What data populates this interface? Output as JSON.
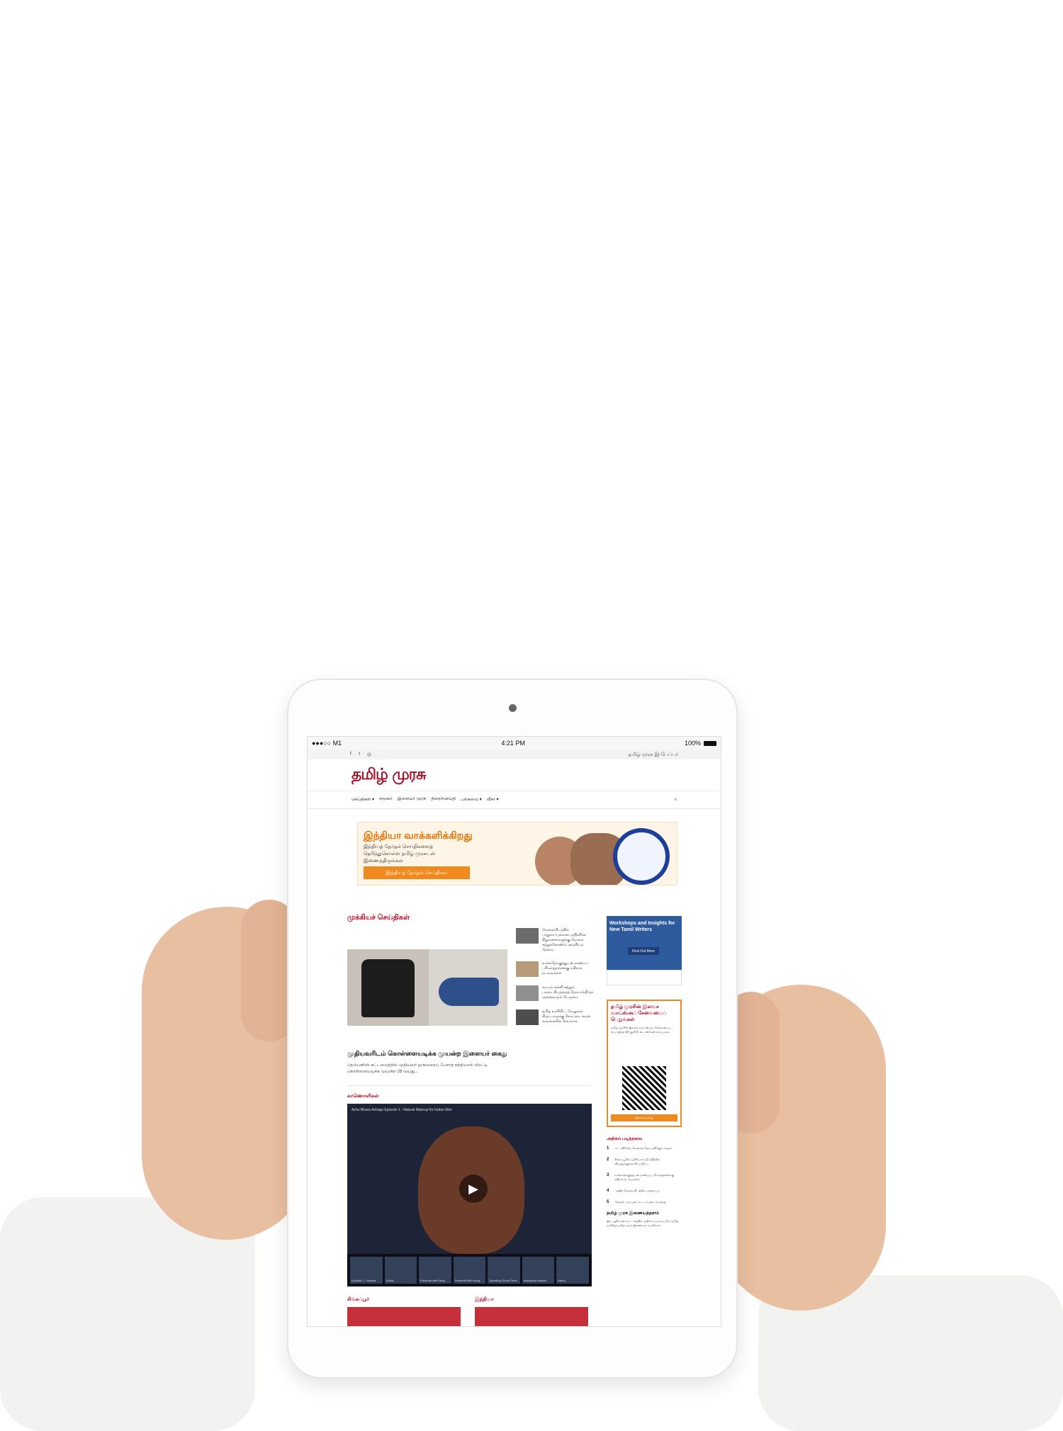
{
  "status": {
    "carrier": "●●●○○ M1",
    "time": "4:21 PM",
    "battery": "100%"
  },
  "topbar": {
    "social": [
      "f",
      "t",
      "◎"
    ],
    "right_link": "தமிழ் முரசு இ-பேப்பர்"
  },
  "brand": {
    "logo": "தமிழ் முரசு"
  },
  "nav": {
    "items": [
      "செய்திகள் ▾",
      "சமூகம்",
      "இளையர் முரசு",
      "திரைச்செய்தி",
      "பல்சுவை ▾",
      "வீசா ▾"
    ],
    "search_icon": "search-icon"
  },
  "banner": {
    "headline": "இந்தியா வாக்களிக்கிறது",
    "sub": "இந்தியத் தேர்தல் செய்திகளைத் தெரிந்துகொள்ள தமிழ் முரசுடன் இணைந்திருங்கள்",
    "cta": "இந்தியத் தேர்தல் செய்திகள்"
  },
  "main": {
    "section_title": "முக்கியச் செய்திகள்",
    "lead_title": "முதியவரிடம் கொள்ளையடிக்க முயன்ற இளையர் கைது",
    "lead_sub": "தெம்பனிஸ் கட்டமைத்தில் முதியவர் ஒருவரைப் பேசாத கத்தியால் மிரட்டி கொள்ளையடிக்க முயன்ற 28 வயது...",
    "side_items": [
      "வேலையிடத்தில் பாதுகாப்புக்கான அதிகரிக்க நிறுவனங்களுக்கு வேலை கற்றுக்கொண்டு அவசியம் தேவை",
      "உள்ளதொகுத்துடன் நாணயப் பரிவர்த்தனைக்கு எதிராக நடவடிக்கை",
      "சமயம் கல்வி கற்றும் பாரம்பரியத்தைத் தொடர்ந்திடும் அனைவரும் பெருமை",
      "தமிழ் உச்சிபிட, வேலுகள் கிருப்பாவுக்கு கோட்டை கடின காலங்களில் செயலாக்"
    ],
    "video_label": "காணொளிகள்",
    "video_caption": "Azhu Bhava Azhagu Episode 1 - Natural Makeup for Indian Skin",
    "video_thumbs": [
      "Episode 1 - Natural",
      "Sotlok",
      "Personal with Kang",
      "Personal With Kang",
      "Speaking Fluent Tamil",
      "Narayana mission",
      "Merry"
    ],
    "cat_labels": [
      "சிங்கப்பூர்",
      "இந்தியா"
    ]
  },
  "right": {
    "ad1_title": "Workshops and Insights for New Tamil Writers",
    "ad1_button": "Find Out More",
    "ad2_title": "தமிழ் முரசின் இலவச வாட்ஸ்அப் சேவையைப் பெறுங்கள்",
    "ad2_desc": "தமிழ் முரசின் இலவச வாட்ஸ்அப் சேவையைப் பெற இந்த QR குறியீட்டை ஸ்கேன் செய்யவும்",
    "ad2_button": "இணைவதற்கு",
    "popular_title": "அதிகம் படித்தவை",
    "popular": [
      {
        "n": "1",
        "t": "சட்டவிரோத வேலைத் தேடி தவிக்கும் கடிதம்"
      },
      {
        "n": "2",
        "t": "சிங்கப்பூரில் முதியோர் நடு வீதியில் விபத்துக்குள்ளாகி பாதிப்பு"
      },
      {
        "n": "3",
        "t": "உள்ளதொகுத்துடன் நாணயப் பரிவர்த்தனைக்கு எதிராக நடவடிக்கை"
      },
      {
        "n": "4",
        "t": "அஜிக் வேலையிடத்தில் பாதுகாப்பு"
      },
      {
        "n": "5",
        "t": "தேர்தல் பரப்புரை கூட்டம் நடைபெற்றது"
      }
    ],
    "partner_title": "தமிழ் முரசு இணையத்தளம்",
    "partner_desc": "இடி ஆசியான் வட்டாரத்தில் அதிகம் படிக்கப்படும் தமிழ் நாளிதழ் தமிழ் முரசு இணையம் வாயிலாக..."
  }
}
